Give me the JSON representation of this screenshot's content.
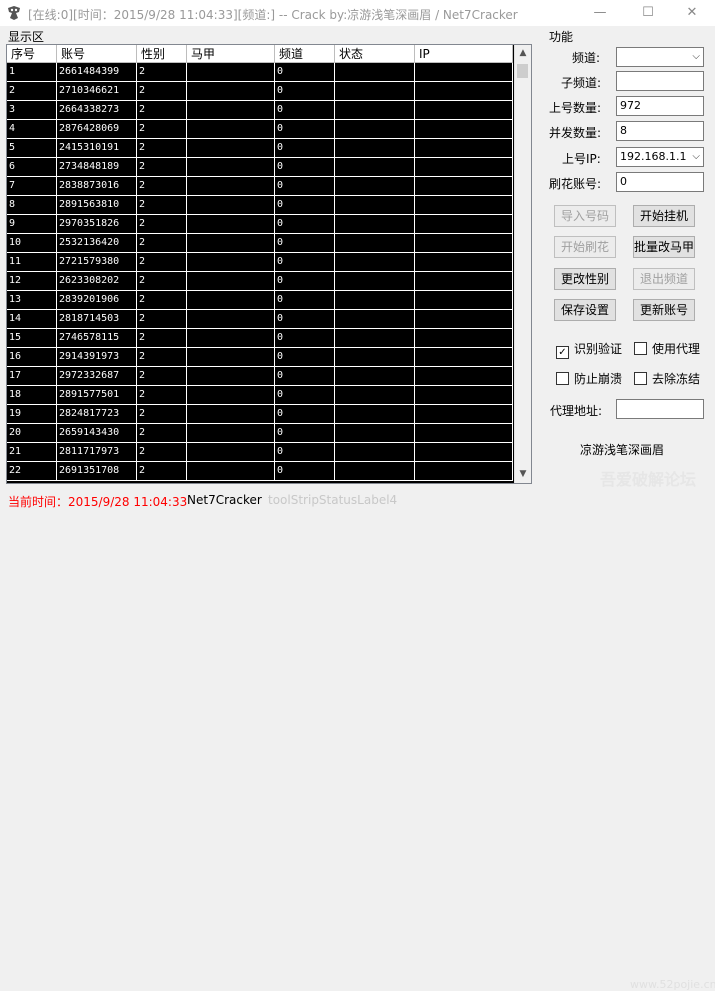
{
  "window": {
    "title": "[在线:0][时间：2015/9/28 11:04:33][频道:] -- Crack by:凉游浅笔深画眉 / Net7Cracker",
    "minimize": "—",
    "maximize": "☐",
    "close": "✕"
  },
  "display": {
    "label": "显示区",
    "columns": [
      "序号",
      "账号",
      "性别",
      "马甲",
      "频道",
      "状态",
      "IP"
    ],
    "rows": [
      [
        "1",
        "2661484399",
        "2",
        "",
        "0",
        "",
        ""
      ],
      [
        "2",
        "2710346621",
        "2",
        "",
        "0",
        "",
        ""
      ],
      [
        "3",
        "2664338273",
        "2",
        "",
        "0",
        "",
        ""
      ],
      [
        "4",
        "2876428069",
        "2",
        "",
        "0",
        "",
        ""
      ],
      [
        "5",
        "2415310191",
        "2",
        "",
        "0",
        "",
        ""
      ],
      [
        "6",
        "2734848189",
        "2",
        "",
        "0",
        "",
        ""
      ],
      [
        "7",
        "2838873016",
        "2",
        "",
        "0",
        "",
        ""
      ],
      [
        "8",
        "2891563810",
        "2",
        "",
        "0",
        "",
        ""
      ],
      [
        "9",
        "2970351826",
        "2",
        "",
        "0",
        "",
        ""
      ],
      [
        "10",
        "2532136420",
        "2",
        "",
        "0",
        "",
        ""
      ],
      [
        "11",
        "2721579380",
        "2",
        "",
        "0",
        "",
        ""
      ],
      [
        "12",
        "2623308202",
        "2",
        "",
        "0",
        "",
        ""
      ],
      [
        "13",
        "2839201906",
        "2",
        "",
        "0",
        "",
        ""
      ],
      [
        "14",
        "2818714503",
        "2",
        "",
        "0",
        "",
        ""
      ],
      [
        "15",
        "2746578115",
        "2",
        "",
        "0",
        "",
        ""
      ],
      [
        "16",
        "2914391973",
        "2",
        "",
        "0",
        "",
        ""
      ],
      [
        "17",
        "2972332687",
        "2",
        "",
        "0",
        "",
        ""
      ],
      [
        "18",
        "2891577501",
        "2",
        "",
        "0",
        "",
        ""
      ],
      [
        "19",
        "2824817723",
        "2",
        "",
        "0",
        "",
        ""
      ],
      [
        "20",
        "2659143430",
        "2",
        "",
        "0",
        "",
        ""
      ],
      [
        "21",
        "2811717973",
        "2",
        "",
        "0",
        "",
        ""
      ],
      [
        "22",
        "2691351708",
        "2",
        "",
        "0",
        "",
        ""
      ]
    ]
  },
  "panel": {
    "label": "功能",
    "channel_label": "频道:",
    "channel_value": "",
    "subchannel_label": "子频道:",
    "subchannel_value": "",
    "login_count_label": "上号数量:",
    "login_count_value": "972",
    "concurrency_label": "并发数量:",
    "concurrency_value": "8",
    "ip_label": "上号IP:",
    "ip_value": "192.168.1.1",
    "flower_label": "刷花账号:",
    "flower_value": "0",
    "buttons": {
      "import": "导入号码",
      "start_hang": "开始挂机",
      "start_flower": "开始刷花",
      "batch_rename": "批量改马甲",
      "change_gender": "更改性别",
      "exit_channel": "退出频道",
      "save_settings": "保存设置",
      "refresh_accounts": "更新账号"
    },
    "checkboxes": {
      "captcha": "识别验证",
      "proxy": "使用代理",
      "anti_crash": "防止崩溃",
      "unfreeze": "去除冻结"
    },
    "proxy_address_label": "代理地址:",
    "proxy_address_value": "",
    "credit": "凉游浅笔深画眉"
  },
  "status": {
    "time": "当前时间：2015/9/28 11:04:33",
    "app": "Net7Cracker",
    "label4": "toolStripStatusLabel4",
    "time_color": "#ff0000"
  },
  "watermark": {
    "text": "吾爱破解论坛",
    "url": "www.52pojie.cn"
  }
}
